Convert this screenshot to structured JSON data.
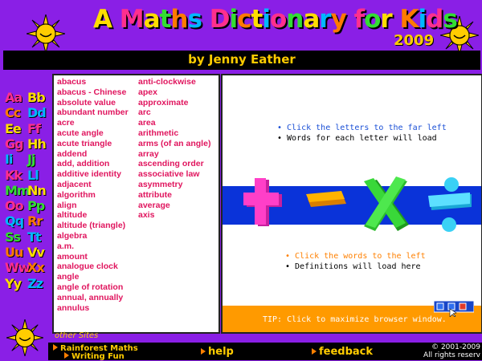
{
  "header": {
    "title_chars": [
      {
        "ch": "A",
        "color": "#ffdd00"
      },
      {
        "ch": " ",
        "color": "#fff"
      },
      {
        "ch": "M",
        "color": "#ff2f8e"
      },
      {
        "ch": "a",
        "color": "#ffdd00"
      },
      {
        "ch": "t",
        "color": "#33dd33"
      },
      {
        "ch": "h",
        "color": "#ff7a00"
      },
      {
        "ch": "s",
        "color": "#00b7ff"
      },
      {
        "ch": " ",
        "color": "#fff"
      },
      {
        "ch": "D",
        "color": "#ff2f8e"
      },
      {
        "ch": "i",
        "color": "#33dd33"
      },
      {
        "ch": "c",
        "color": "#ff7a00"
      },
      {
        "ch": "t",
        "color": "#ffdd00"
      },
      {
        "ch": "i",
        "color": "#00b7ff"
      },
      {
        "ch": "o",
        "color": "#ff2f8e"
      },
      {
        "ch": "n",
        "color": "#33dd33"
      },
      {
        "ch": "a",
        "color": "#ffdd00"
      },
      {
        "ch": "r",
        "color": "#00b7ff"
      },
      {
        "ch": "y",
        "color": "#ff7a00"
      },
      {
        "ch": " ",
        "color": "#fff"
      },
      {
        "ch": "f",
        "color": "#ff2f8e"
      },
      {
        "ch": "o",
        "color": "#33dd33"
      },
      {
        "ch": "r",
        "color": "#ffdd00"
      },
      {
        "ch": " ",
        "color": "#fff"
      },
      {
        "ch": "K",
        "color": "#ff7a00"
      },
      {
        "ch": "i",
        "color": "#00b7ff"
      },
      {
        "ch": "d",
        "color": "#ff2f8e"
      },
      {
        "ch": "s",
        "color": "#33dd33"
      }
    ],
    "year": "2009",
    "byline": "by Jenny Eather"
  },
  "letters": [
    {
      "text": "Aa",
      "color": "#ff2f8e"
    },
    {
      "text": "Bb",
      "color": "#ffdd00"
    },
    {
      "text": "Cc",
      "color": "#ff7a00"
    },
    {
      "text": "Dd",
      "color": "#00b7ff"
    },
    {
      "text": "Ee",
      "color": "#ffdd00"
    },
    {
      "text": "Ff",
      "color": "#ff2f8e"
    },
    {
      "text": "Gg",
      "color": "#ff2f8e"
    },
    {
      "text": "Hh",
      "color": "#ffdd00"
    },
    {
      "text": "Ii",
      "color": "#00b7ff"
    },
    {
      "text": "Jj",
      "color": "#33dd33"
    },
    {
      "text": "Kk",
      "color": "#ff2f8e"
    },
    {
      "text": "Ll",
      "color": "#00b7ff"
    },
    {
      "text": "Mm",
      "color": "#33dd33"
    },
    {
      "text": "Nn",
      "color": "#ffdd00"
    },
    {
      "text": "Oo",
      "color": "#ff2f8e"
    },
    {
      "text": "Pp",
      "color": "#33dd33"
    },
    {
      "text": "Qq",
      "color": "#00b7ff"
    },
    {
      "text": "Rr",
      "color": "#ff7a00"
    },
    {
      "text": "Ss",
      "color": "#33dd33"
    },
    {
      "text": "Tt",
      "color": "#00b7ff"
    },
    {
      "text": "Uu",
      "color": "#ff7a00"
    },
    {
      "text": "Vv",
      "color": "#ffdd00"
    },
    {
      "text": "Ww",
      "color": "#ff2f8e"
    },
    {
      "text": "Xx",
      "color": "#ff7a00"
    },
    {
      "text": "Yy",
      "color": "#ffdd00"
    },
    {
      "text": "Zz",
      "color": "#00b7ff"
    }
  ],
  "words_col1": [
    "abacus",
    "abacus -  Chinese",
    "absolute value",
    "abundant number",
    "acre",
    "acute angle",
    "acute triangle",
    "addend",
    "add, addition",
    "additive identity",
    "adjacent",
    "algorithm",
    "align",
    "altitude",
    "altitude (triangle)",
    "algebra",
    "a.m.",
    "amount",
    "analogue clock",
    "angle",
    "angle of rotation",
    "annual, annually",
    "annulus"
  ],
  "words_col2": [
    "anti-clockwise",
    "apex",
    "approximate",
    "arc",
    "area",
    "arithmetic",
    "arms (of an angle)",
    "array",
    "ascending order",
    "associative law",
    "asymmetry",
    "attribute",
    "average",
    "axis"
  ],
  "main": {
    "line1": "• Click the letters to the far left",
    "line2": "• Words for each letter will load",
    "line3": "• Click the words to the left",
    "line4": "• Definitions will load here",
    "tip": "TIP: Click to maximize browser window."
  },
  "footer": {
    "other_sites": "other Sites",
    "rainforest": "Rainforest Maths",
    "writing": "Writing Fun",
    "help": "help",
    "feedback": "feedback",
    "copyright1": "© 2001-2009",
    "copyright2": "All rights reserv"
  },
  "colors": {
    "background": "#8a1fe6",
    "accent": "#ffcc00",
    "word_pink": "#e0155e"
  },
  "icons": [
    "sun-icon",
    "plus-icon",
    "minus-icon",
    "times-icon",
    "divide-icon",
    "window-icon",
    "arrow-icon"
  ]
}
